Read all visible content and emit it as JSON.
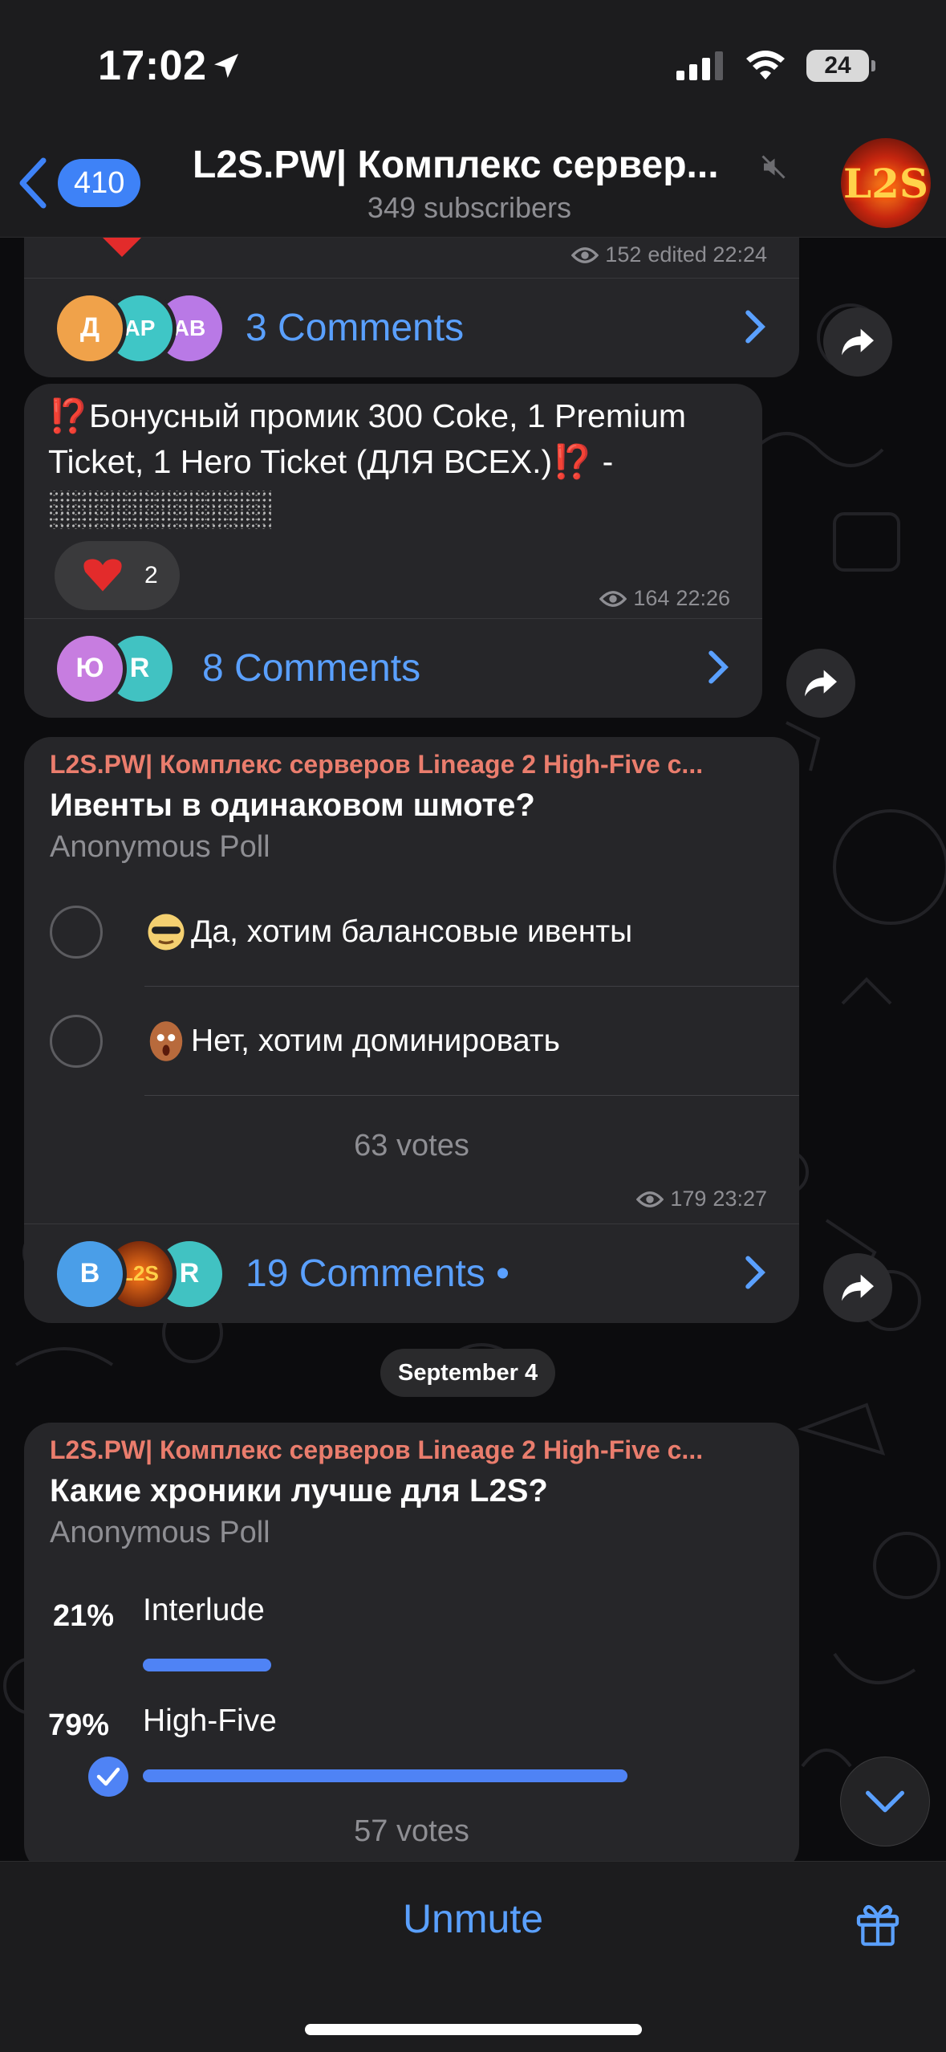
{
  "status_bar": {
    "time": "17:02",
    "battery": "24"
  },
  "header": {
    "back_count": "410",
    "title": "L2S.PW| Комплекс сервер...",
    "subtitle": "349 subscribers",
    "avatar_text": "L2S"
  },
  "messages": [
    {
      "meta_views": "152",
      "meta_time": "edited 22:24",
      "avatars": [
        "Д",
        "АР",
        "АВ"
      ],
      "comments": "3 Comments"
    },
    {
      "text": "⁉️Бонусный промик 300 Coke, 1 Premium Ticket, 1 Hero Ticket (ДЛЯ ВСЕХ.)⁉️ -",
      "reaction_count": "2",
      "meta_views": "164",
      "meta_time": "22:26",
      "avatars": [
        "Ю",
        "R"
      ],
      "comments": "8 Comments"
    },
    {
      "source": "L2S.PW| Комплекс серверов Lineage 2 High-Five с...",
      "question": "Ивенты в одинаковом шмоте?",
      "poll_type": "Anonymous Poll",
      "options": [
        "Да, хотим балансовые ивенты",
        "Нет, хотим доминировать"
      ],
      "votes": "63 votes",
      "meta_views": "179",
      "meta_time": "23:27",
      "avatars": [
        "B",
        "L2S",
        "R"
      ],
      "comments": "19 Comments •"
    }
  ],
  "date_separator": "September 4",
  "poll_results": {
    "source": "L2S.PW| Комплекс серверов Lineage 2 High-Five с...",
    "question": "Какие хроники лучше для L2S?",
    "poll_type": "Anonymous Poll",
    "results": [
      {
        "pct": "21%",
        "label": "Interlude",
        "fraction": 0.21,
        "chosen": false
      },
      {
        "pct": "79%",
        "label": "High-Five",
        "fraction": 0.79,
        "chosen": true
      }
    ],
    "votes": "57 votes"
  },
  "bottom_bar": {
    "unmute_label": "Unmute"
  },
  "colors": {
    "accent": "#4f83f5",
    "link": "#5aa0ff",
    "source_name": "#ea7d6d",
    "bubble": "#262629"
  },
  "icons": [
    "location-arrow-icon",
    "signal-icon",
    "wifi-icon",
    "battery-icon",
    "back-chevron-icon",
    "mute-icon",
    "eye-icon",
    "chevron-right-icon",
    "share-icon",
    "heart-icon",
    "checkmark-icon",
    "chevron-down-icon",
    "gift-icon"
  ]
}
